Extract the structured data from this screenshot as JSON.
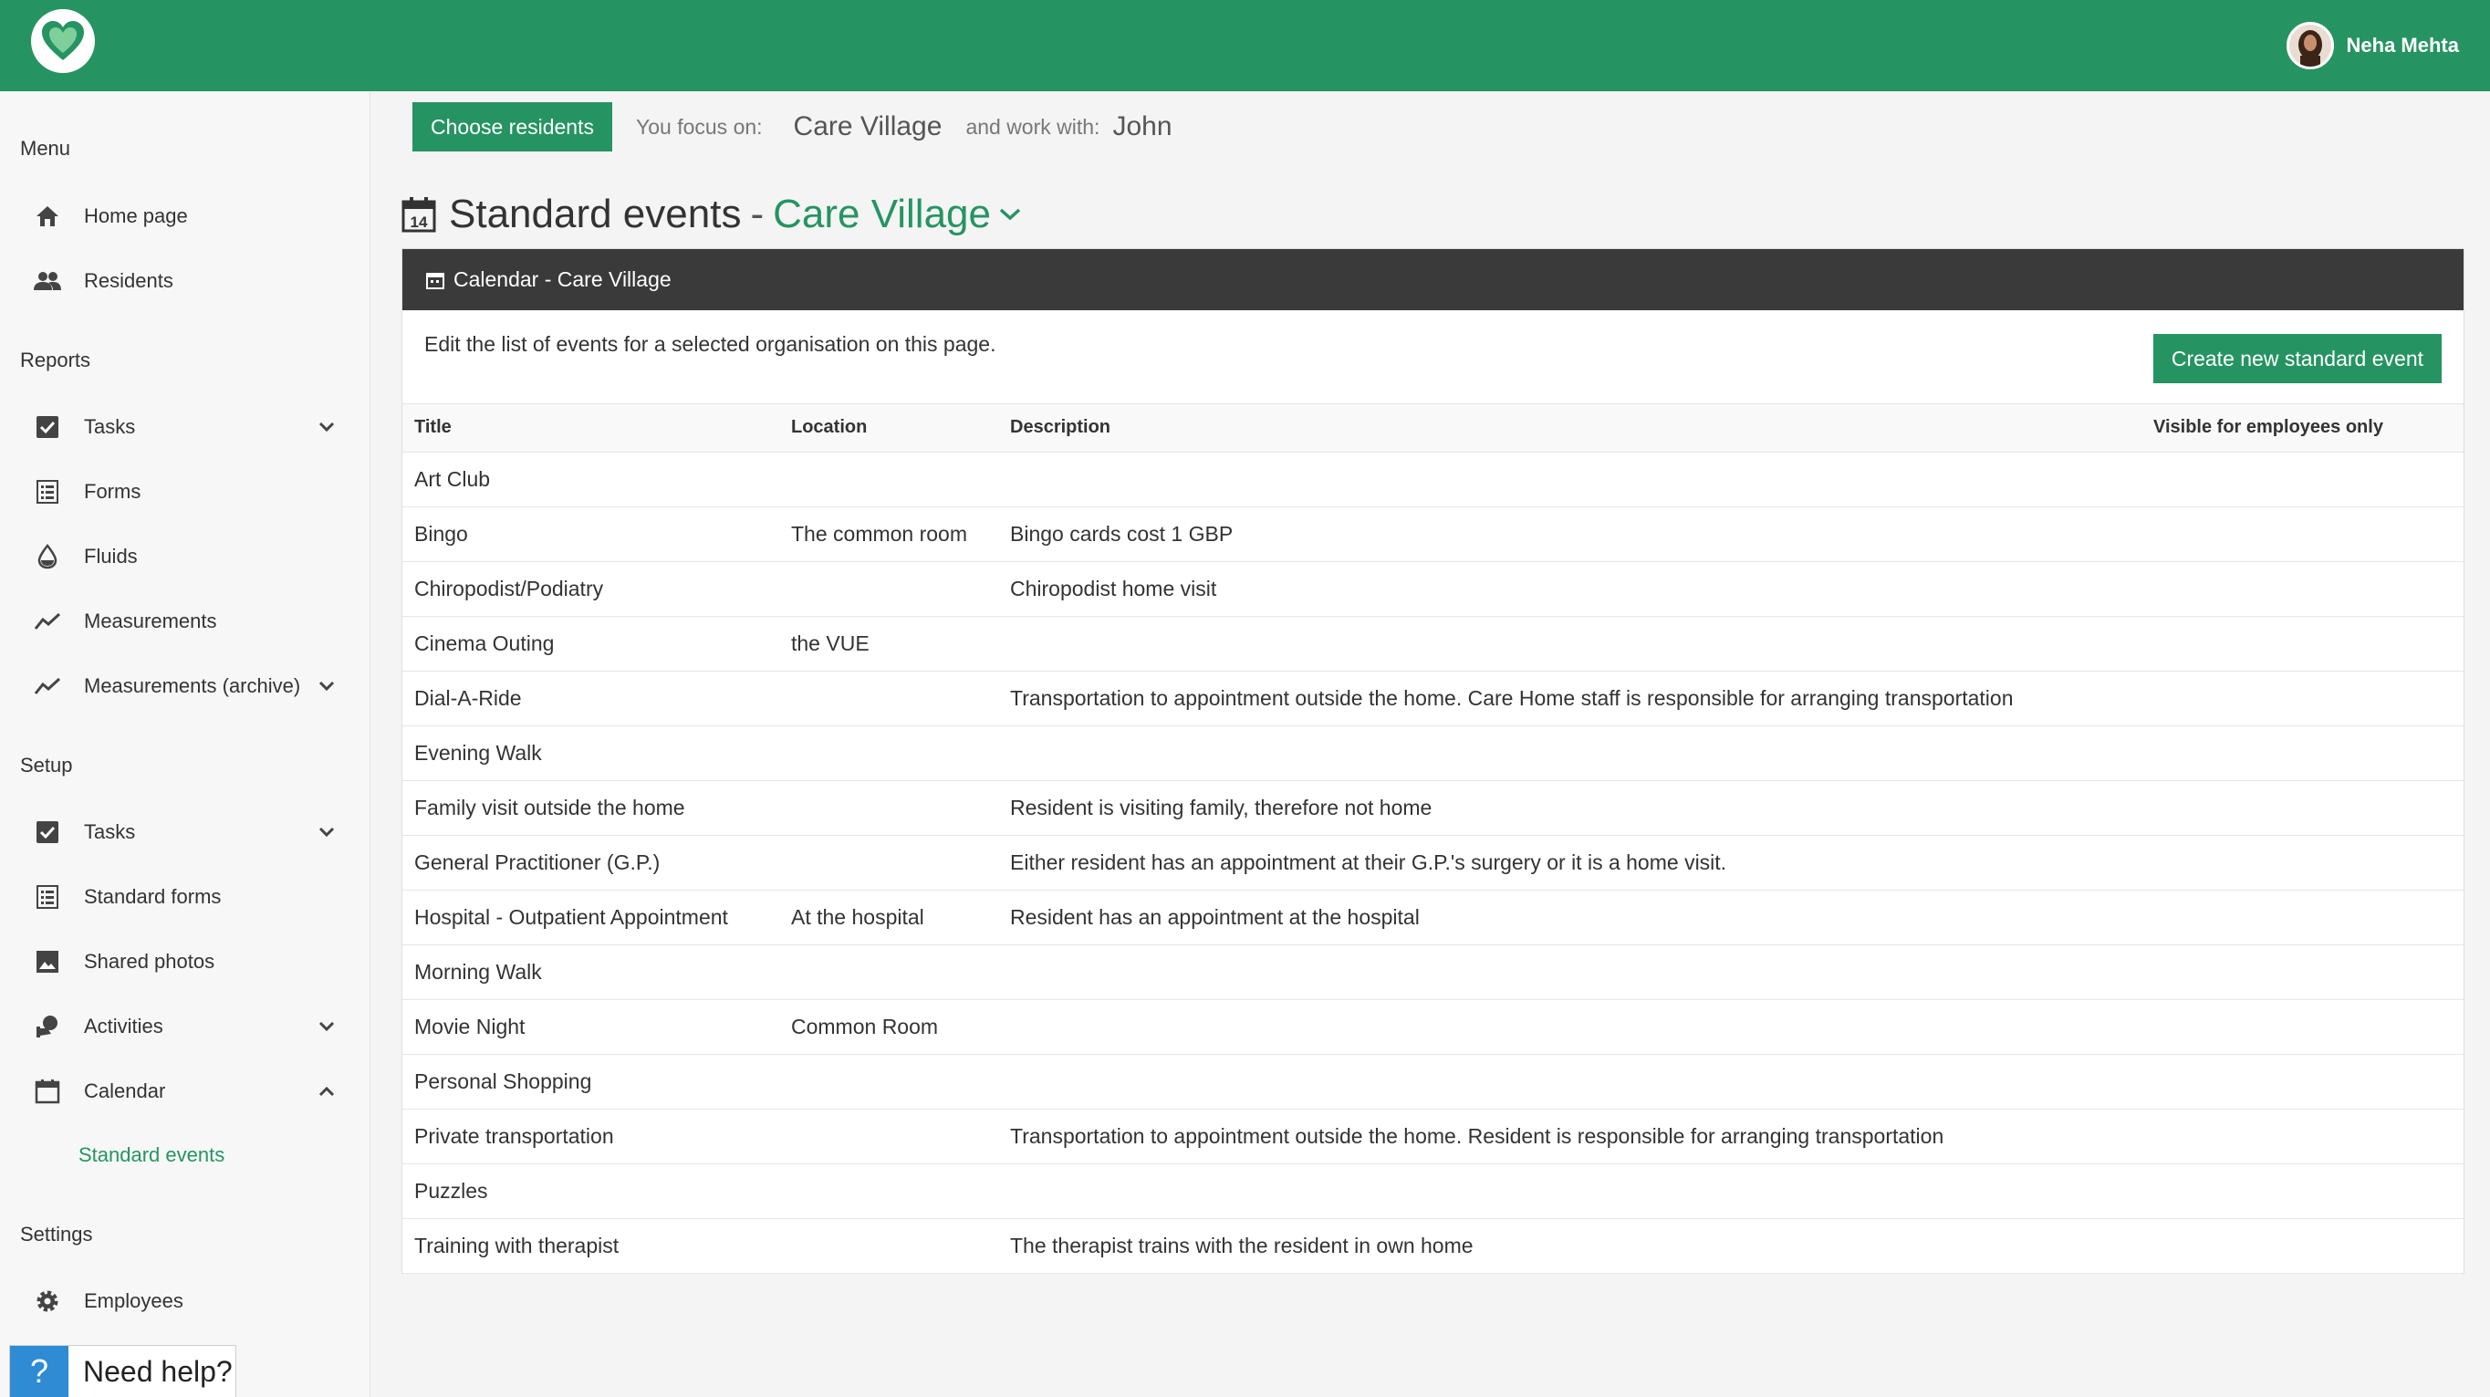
{
  "header": {
    "user_name": "Neha Mehta"
  },
  "sidebar": {
    "menu_heading": "Menu",
    "menu_items": [
      {
        "label": "Home page",
        "icon": "home-icon"
      },
      {
        "label": "Residents",
        "icon": "people-icon"
      }
    ],
    "reports_heading": "Reports",
    "reports_items": [
      {
        "label": "Tasks",
        "icon": "checkbox-icon",
        "expandable": true
      },
      {
        "label": "Forms",
        "icon": "list-icon"
      },
      {
        "label": "Fluids",
        "icon": "drop-icon"
      },
      {
        "label": "Measurements",
        "icon": "trend-icon"
      },
      {
        "label": "Measurements (archive)",
        "icon": "trend-icon",
        "expandable": true
      }
    ],
    "setup_heading": "Setup",
    "setup_items": [
      {
        "label": "Tasks",
        "icon": "checkbox-icon",
        "expandable": true
      },
      {
        "label": "Standard forms",
        "icon": "list-icon"
      },
      {
        "label": "Shared photos",
        "icon": "image-icon"
      },
      {
        "label": "Activities",
        "icon": "activity-icon",
        "expandable": true
      },
      {
        "label": "Calendar",
        "icon": "calendar-icon",
        "expanded": true
      }
    ],
    "calendar_sub": "Standard events",
    "settings_heading": "Settings",
    "settings_items": [
      {
        "label": "Employees",
        "icon": "gear-icon"
      }
    ],
    "help_label": "Need help?",
    "help_symbol": "?"
  },
  "focus": {
    "choose_button": "Choose residents",
    "focus_label": "You focus on:",
    "focus_value": "Care Village",
    "work_label": "and work with:",
    "work_value": "John"
  },
  "page": {
    "title": "Standard events",
    "separator": "-",
    "organisation": "Care Village"
  },
  "panel": {
    "header": "Calendar - Care Village",
    "intro": "Edit the list of events for a selected organisation on this page.",
    "create_button": "Create new standard event",
    "columns": [
      "Title",
      "Location",
      "Description",
      "Visible for employees only"
    ],
    "rows": [
      [
        "Art Club",
        "",
        "",
        ""
      ],
      [
        "Bingo",
        "The common room",
        "Bingo cards cost 1 GBP",
        ""
      ],
      [
        "Chiropodist/Podiatry",
        "",
        "Chiropodist home visit",
        ""
      ],
      [
        "Cinema Outing",
        "the VUE",
        "",
        ""
      ],
      [
        "Dial-A-Ride",
        "",
        "Transportation to appointment outside the home. Care Home staff is responsible for arranging transportation",
        ""
      ],
      [
        "Evening Walk",
        "",
        "",
        ""
      ],
      [
        "Family visit outside the home",
        "",
        "Resident is visiting family, therefore not home",
        ""
      ],
      [
        "General Practitioner (G.P.)",
        "",
        "Either resident has an appointment at their G.P.'s surgery or it is a home visit.",
        ""
      ],
      [
        "Hospital - Outpatient Appointment",
        "At the hospital",
        "Resident has an appointment at the hospital",
        ""
      ],
      [
        "Morning Walk",
        "",
        "",
        ""
      ],
      [
        "Movie Night",
        "Common Room",
        "",
        ""
      ],
      [
        "Personal Shopping",
        "",
        "",
        ""
      ],
      [
        "Private transportation",
        "",
        "Transportation to appointment outside the home. Resident is responsible for arranging transportation",
        ""
      ],
      [
        "Puzzles",
        "",
        "",
        ""
      ],
      [
        "Training with therapist",
        "",
        "The therapist trains with the resident in own home",
        ""
      ]
    ]
  },
  "colors": {
    "brand_green": "#259462",
    "panel_header": "#3a3a3a",
    "help_blue": "#2e8bd4"
  }
}
